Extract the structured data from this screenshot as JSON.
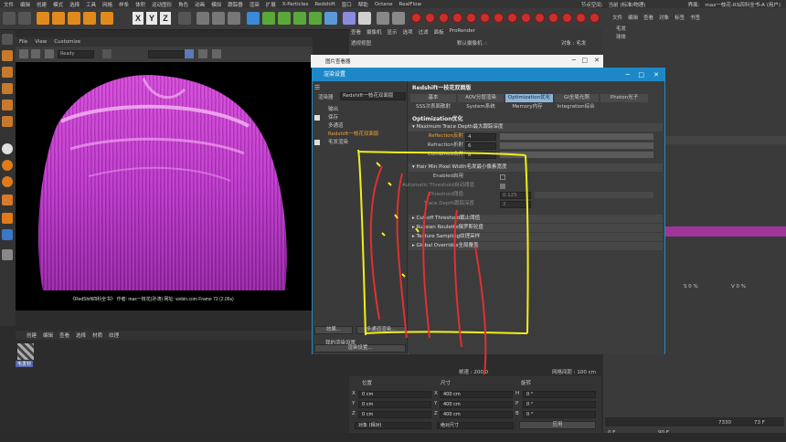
{
  "menubar": {
    "items": [
      "文件",
      "编辑",
      "创建",
      "模式",
      "选择",
      "工具",
      "网格",
      "样条",
      "体积",
      "运动图形",
      "角色",
      "动画",
      "模拟",
      "跟踪器",
      "渲染",
      "扩展",
      "X-Particles",
      "Redshift",
      "窗口",
      "帮助",
      "Octane",
      "RealFlow"
    ],
    "node_space_label": "节点空间:",
    "node_space_value": "当前 (标准/物理)",
    "interface_label": "界面:",
    "interface_value": "max一枝花-RS四科全书-A (用户)"
  },
  "toolbar": {
    "axis_x": "X",
    "axis_y": "Y",
    "axis_z": "Z"
  },
  "viewport": {
    "menu": [
      "File",
      "View",
      "Customize"
    ],
    "render_state": "Ready",
    "render_overlay": "《RedShift四科全书》 作者: max一枝花(孙涛) 网址: wxbin.com  Frame 73 (2.06s)"
  },
  "material_manager": {
    "menu": [
      "创建",
      "编辑",
      "查看",
      "选择",
      "材质",
      "纹理"
    ],
    "material_name": "毛发材"
  },
  "background_window": {
    "menu": [
      "查看",
      "摄像机",
      "显示",
      "选项",
      "过滤",
      "面板",
      "ProRender"
    ],
    "view_label": "透视视图",
    "camera_label": "默认摄像机 ∴",
    "object_label": "对象 : 毛发"
  },
  "picture_viewer": {
    "title": "图片查看器"
  },
  "render_settings": {
    "title": "渲染设置",
    "renderer_label": "渲染器",
    "renderer_value": "Redshift一枝花双面版",
    "left_items": [
      {
        "label": "输出",
        "checked": false
      },
      {
        "label": "保存",
        "checked": true
      },
      {
        "label": "多通道",
        "checked": false
      },
      {
        "label": "Redshift一枝花双面版",
        "checked": false
      },
      {
        "label": "毛发渲染",
        "checked": true
      }
    ],
    "effect_button": "效果...",
    "multipass_button": "多通道渲染...",
    "my_settings": "我的渲染设置",
    "render_settings_button": "渲染设置...",
    "panel_title": "Redshift一枝花双面版",
    "tabs_row1": [
      "基本",
      "AOV分层渲染",
      "Optimization优化",
      "GI全局光照",
      "Photon光子"
    ],
    "tabs_row2": [
      "SSS次表面散射",
      "System系统",
      "Memory内存",
      "Integration综合"
    ],
    "section_title": "Optimization优化",
    "trace_depth_header": "Maximum Trace Depth最大跟踪深度",
    "reflection_label": "Reflection反射",
    "reflection_value": "4",
    "refraction_label": "Refraction折射",
    "refraction_value": "6",
    "combined_label": "Combined合并",
    "combined_value": "6",
    "hair_header": "Hair Min Pixel Width毛发最小像素宽度",
    "enabled_label": "Enabled启用",
    "auto_threshold_label": "Automatic Threshold自动阈值",
    "threshold_label": "Threshold阈值",
    "threshold_value": "0.125",
    "trace_depth_label": "Trace Depth跟踪深度",
    "trace_depth_value": "2",
    "collapsed_sections": [
      "Cut-off Threshold截止阈值",
      "Russian Roulette俄罗斯轮盘",
      "Texture Sampling纹理采样",
      "Global Overrides全局覆盖"
    ]
  },
  "coordinates": {
    "position_label": "位置",
    "size_label": "尺寸",
    "rotation_label": "旋转",
    "rows": [
      {
        "axis": "X",
        "pos": "0 cm",
        "size": "400 cm",
        "rot_axis": "H",
        "rot": "0 °"
      },
      {
        "axis": "Y",
        "pos": "0 cm",
        "size": "400 cm",
        "rot_axis": "P",
        "rot": "0 °"
      },
      {
        "axis": "Z",
        "pos": "0 cm",
        "size": "400 cm",
        "rot_axis": "B",
        "rot": "0 °"
      }
    ],
    "mode_object": "对象 (相对)",
    "mode_size": "绝对尺寸",
    "apply_button": "应用",
    "speed": "帧速 : 200.0",
    "grid": "网格间距 : 100 cm"
  },
  "right_panel": {
    "menu": [
      "文件",
      "编辑",
      "查看",
      "对象",
      "标签",
      "书签"
    ],
    "object_hair": "毛发",
    "object_sphere": "球体",
    "s_value": "0 %",
    "v_value": "0 %",
    "frame_current": "0 F",
    "frame_end": "90 F",
    "frame_right": "73 F",
    "frame_marker": "7330"
  },
  "colors": {
    "accent": "#1e88c6",
    "hair": "#c03ad0",
    "annotation_yellow": "#f2ee1a",
    "annotation_red": "#e03030"
  }
}
